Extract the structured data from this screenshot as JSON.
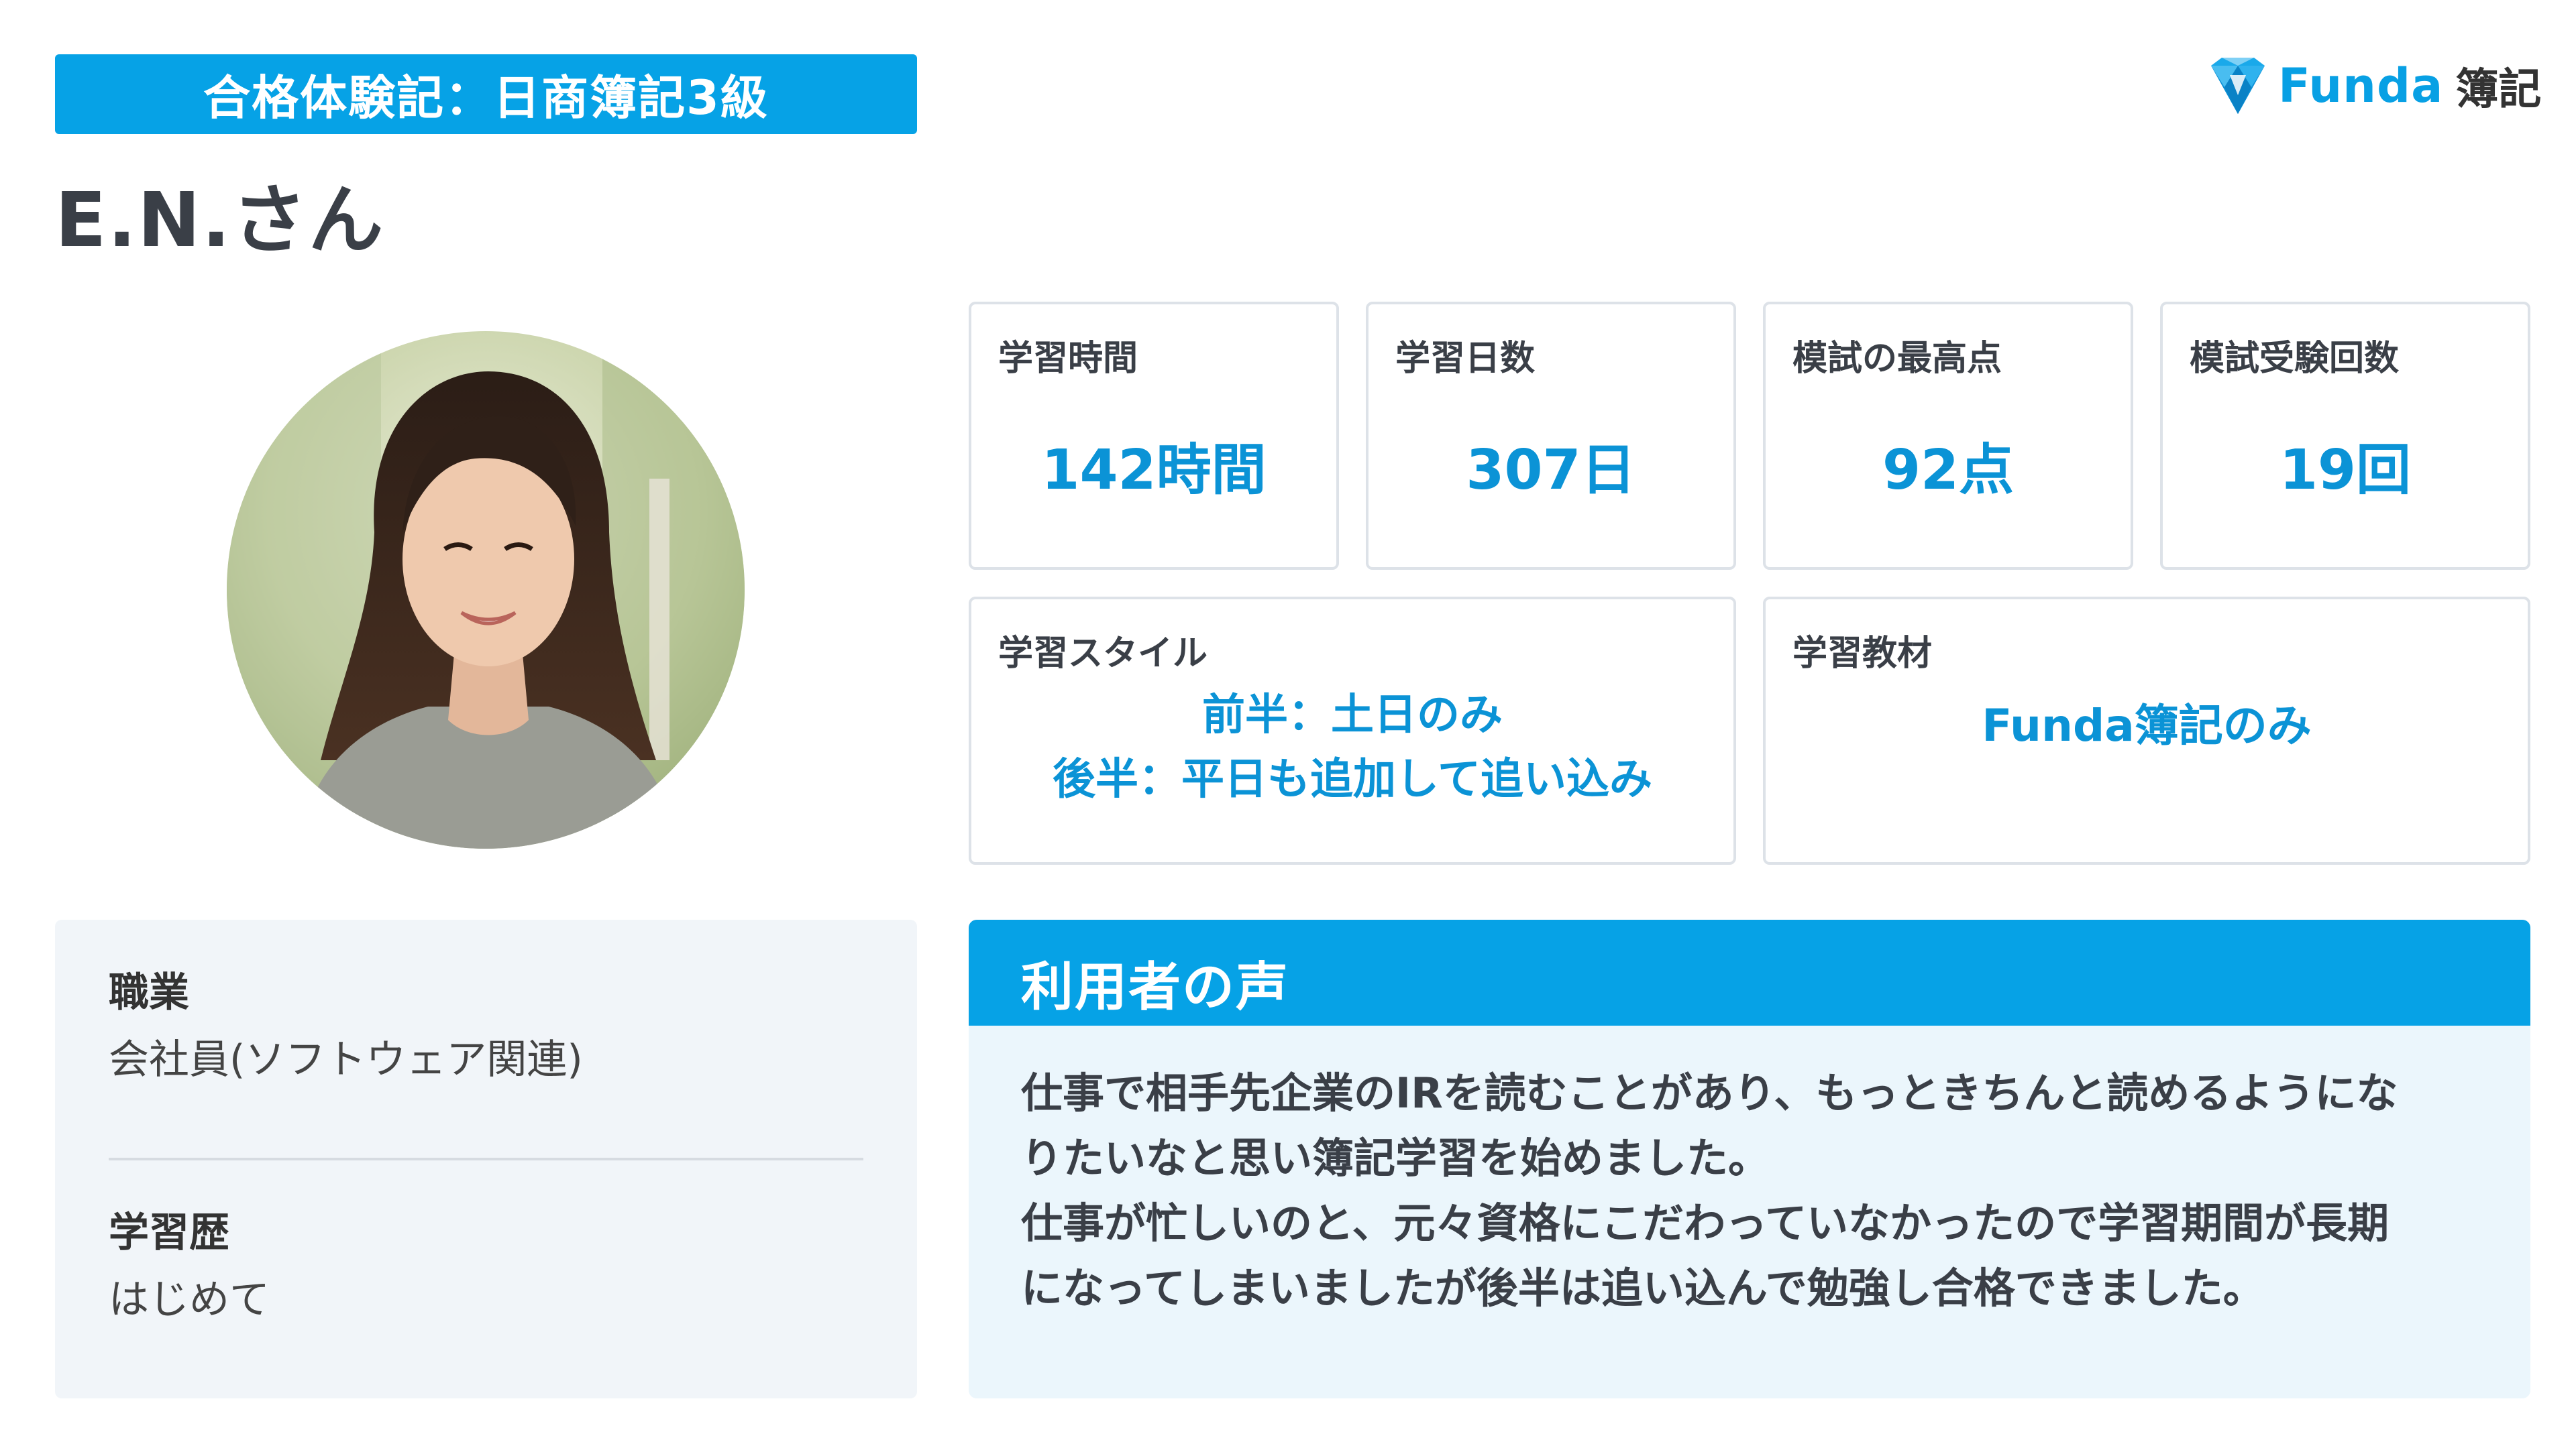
{
  "header": {
    "banner": "合格体験記：日商簿記3級",
    "name": "E.N.さん"
  },
  "logo": {
    "word": "Funda",
    "jp": "簿記",
    "icon": "diamond-gem-icon",
    "brand_color": "#08a0e4"
  },
  "photo": {
    "icon": "portrait-photo"
  },
  "stats": [
    {
      "label": "学習時間",
      "value": "142時間"
    },
    {
      "label": "学習日数",
      "value": "307日"
    },
    {
      "label": "模試の最高点",
      "value": "92点"
    },
    {
      "label": "模試受験回数",
      "value": "19回"
    }
  ],
  "style": {
    "label": "学習スタイル",
    "line1": "前半：土日のみ",
    "line2": "後半：平日も追加して追い込み"
  },
  "material": {
    "label": "学習教材",
    "value": "Funda簿記のみ"
  },
  "profile": {
    "job_label": "職業",
    "job_value": "会社員(ソフトウェア関連)",
    "history_label": "学習歴",
    "history_value": "はじめて"
  },
  "voice": {
    "title": "利用者の声",
    "lines": [
      "仕事で相手先企業のIRを読むことがあり、もっときちんと読めるようにな",
      "りたいなと思い簿記学習を始めました。",
      "仕事が忙しいのと、元々資格にこだわっていなかったので学習期間が長期",
      "になってしまいましたが後半は追い込んで勉強し合格できました。"
    ]
  },
  "colors": {
    "accent": "#06a2e6",
    "value_text": "#0b93d6",
    "panel_bg": "#f1f5f9",
    "voice_bg": "#ebf6fc"
  }
}
